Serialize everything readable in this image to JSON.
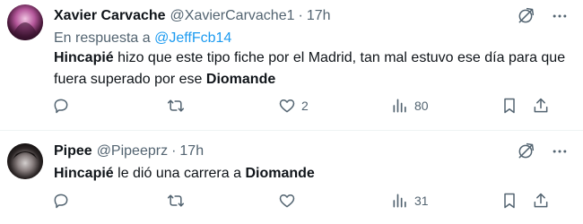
{
  "tweets": [
    {
      "name": "Xavier Carvache",
      "handle": "@XavierCarvache1",
      "dot": "·",
      "time": "17h",
      "reply_prefix": "En respuesta a",
      "reply_mention": "@JeffFcb14",
      "text_bold1": "Hincapié",
      "text_mid": " hizo que este tipo fiche por el Madrid, tan mal estuvo ese día para que fuera superado por ese ",
      "text_bold2": "Diomande",
      "replies": "",
      "retweets": "",
      "likes": "2",
      "views": "80"
    },
    {
      "name": "Pipee",
      "handle": "@Pipeeprz",
      "dot": "·",
      "time": "17h",
      "text_bold1": "Hincapié",
      "text_mid": " le dió una carrera a ",
      "text_bold2": "Diomande",
      "replies": "",
      "retweets": "",
      "likes": "",
      "views": "31"
    }
  ],
  "icons": {
    "top": [
      "grok-icon",
      "more-icon"
    ],
    "actions": [
      "reply-icon",
      "retweet-icon",
      "like-icon",
      "views-icon",
      "bookmark-icon",
      "share-icon"
    ]
  },
  "colors": {
    "accent": "#1d9bf0",
    "muted": "#536471",
    "text": "#0f1419"
  }
}
